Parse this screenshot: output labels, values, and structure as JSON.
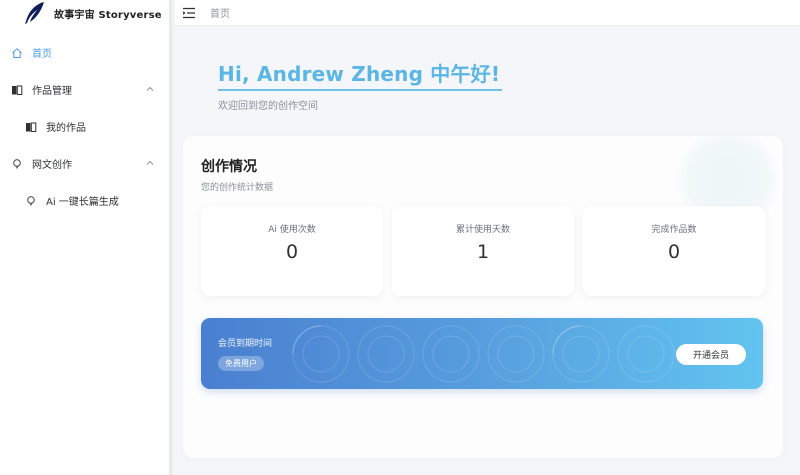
{
  "app": {
    "name": "故事宇宙 Storyverse",
    "accent_color": "#4a9ce8",
    "logo_icon": "feather-quill-icon"
  },
  "sidebar": {
    "items": [
      {
        "label": "首页",
        "icon": "home-icon",
        "active": true
      },
      {
        "label": "作品管理",
        "icon": "book-icon",
        "expanded": true
      },
      {
        "label": "我的作品",
        "icon": "book-icon"
      },
      {
        "label": "网文创作",
        "icon": "lightbulb-icon",
        "expanded": true
      },
      {
        "label": "Ai 一键长篇生成",
        "icon": "lightbulb-icon"
      }
    ]
  },
  "header": {
    "collapse_icon": "menu-fold-icon",
    "breadcrumb": "首页"
  },
  "greeting": {
    "title": "Hi, Andrew Zheng 中午好!",
    "subtitle": "欢迎回到您的创作空间",
    "color": "#5ab6e6"
  },
  "stats_panel": {
    "title": "创作情况",
    "subtitle": "您的创作统计数据",
    "stats": [
      {
        "label": "Ai 使用次数",
        "value": "0"
      },
      {
        "label": "累计使用天数",
        "value": "1"
      },
      {
        "label": "完成作品数",
        "value": "0"
      }
    ]
  },
  "membership": {
    "label": "会员到期时间",
    "badge": "免费用户",
    "button": "开通会员",
    "gradient": [
      "#4a7fd0",
      "#62c4ef"
    ]
  }
}
